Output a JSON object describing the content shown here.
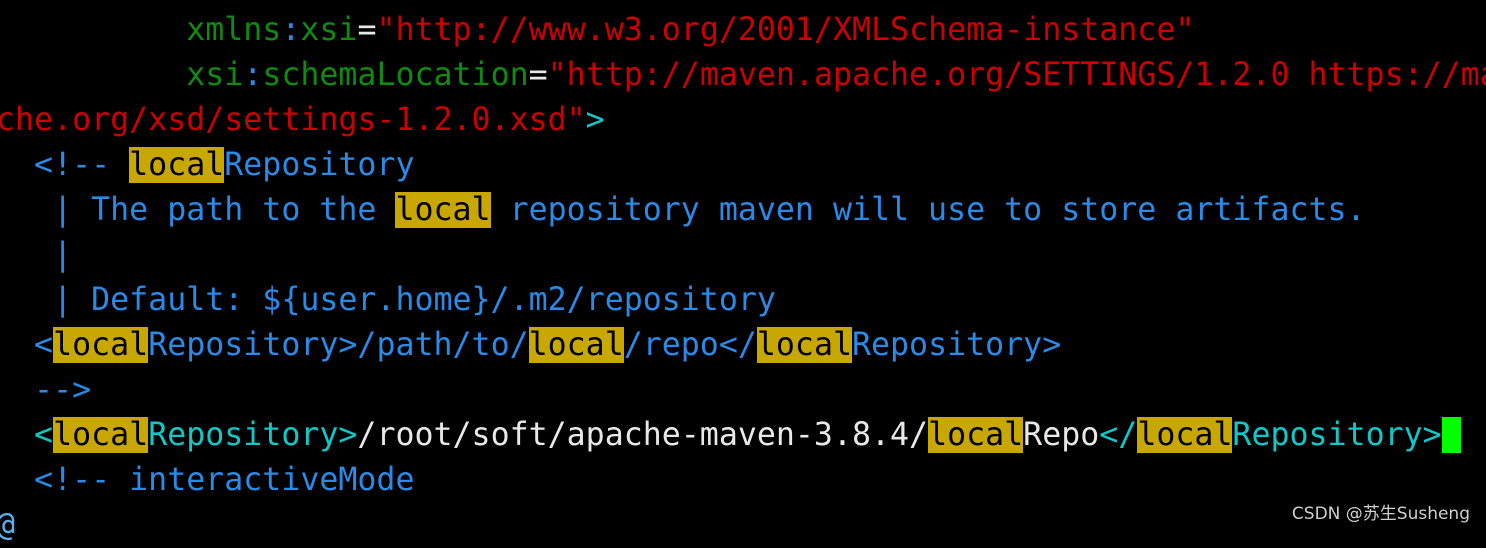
{
  "editor": {
    "lines": [
      [
        [
          "    ",
          "w"
        ],
        [
          ">",
          "c"
        ]
      ],
      [
        [
          "          ",
          "w"
        ],
        [
          "xmlns",
          "g"
        ],
        [
          ":",
          "bl"
        ],
        [
          "xsi",
          "g"
        ],
        [
          "=",
          "w"
        ],
        [
          "\"http://www.w3.org/2001/XMLSchema-instance\"",
          "r"
        ]
      ],
      [
        [
          "          ",
          "w"
        ],
        [
          "xsi",
          "g"
        ],
        [
          ":",
          "bl"
        ],
        [
          "schemaLocation",
          "g"
        ],
        [
          "=",
          "w"
        ],
        [
          "\"http://maven.apache.org/SETTINGS/1.2.0 https://ma",
          "r"
        ]
      ],
      [
        [
          "che.org/xsd/settings-1.2.0.xsd\"",
          "r"
        ],
        [
          ">",
          "c"
        ]
      ],
      [
        [
          "  ",
          "w"
        ],
        [
          "<!-- ",
          "b"
        ],
        [
          "local",
          "hl"
        ],
        [
          "Repository",
          "b"
        ]
      ],
      [
        [
          "   ",
          "w"
        ],
        [
          "| The path to the ",
          "b"
        ],
        [
          "local",
          "hl"
        ],
        [
          " repository maven will use to store artifacts.",
          "b"
        ]
      ],
      [
        [
          "   ",
          "w"
        ],
        [
          "|",
          "b"
        ]
      ],
      [
        [
          "   ",
          "w"
        ],
        [
          "| Default: ${user.home}/.m2/repository",
          "b"
        ]
      ],
      [
        [
          "  ",
          "w"
        ],
        [
          "<",
          "b"
        ],
        [
          "local",
          "hl"
        ],
        [
          "Repository>/path/to/",
          "b"
        ],
        [
          "local",
          "hl"
        ],
        [
          "/repo</",
          "b"
        ],
        [
          "local",
          "hl"
        ],
        [
          "Repository>",
          "b"
        ]
      ],
      [
        [
          "  ",
          "w"
        ],
        [
          "-->",
          "b"
        ]
      ],
      [
        [
          "  ",
          "w"
        ],
        [
          "<",
          "c"
        ],
        [
          "local",
          "hl"
        ],
        [
          "Repository>",
          "c"
        ],
        [
          "/root/soft/apache-maven-3.8.4/",
          "w"
        ],
        [
          "local",
          "hl"
        ],
        [
          "Repo",
          "w"
        ],
        [
          "</",
          "c"
        ],
        [
          "local",
          "hl"
        ],
        [
          "Repository>",
          "c"
        ],
        [
          " ",
          "cur"
        ]
      ],
      [
        [
          "  ",
          "w"
        ],
        [
          "<!-- interactiveMode",
          "b"
        ]
      ],
      [
        [
          "@",
          "at"
        ]
      ]
    ]
  },
  "watermark": "CSDN @苏生Susheng",
  "colors": {
    "attr": "#108a10",
    "string": "#cc0000",
    "tag": "#10c8c8",
    "comment": "#2a8ae8",
    "search_highlight": "#c8a800",
    "cursor": "#00ff00"
  }
}
